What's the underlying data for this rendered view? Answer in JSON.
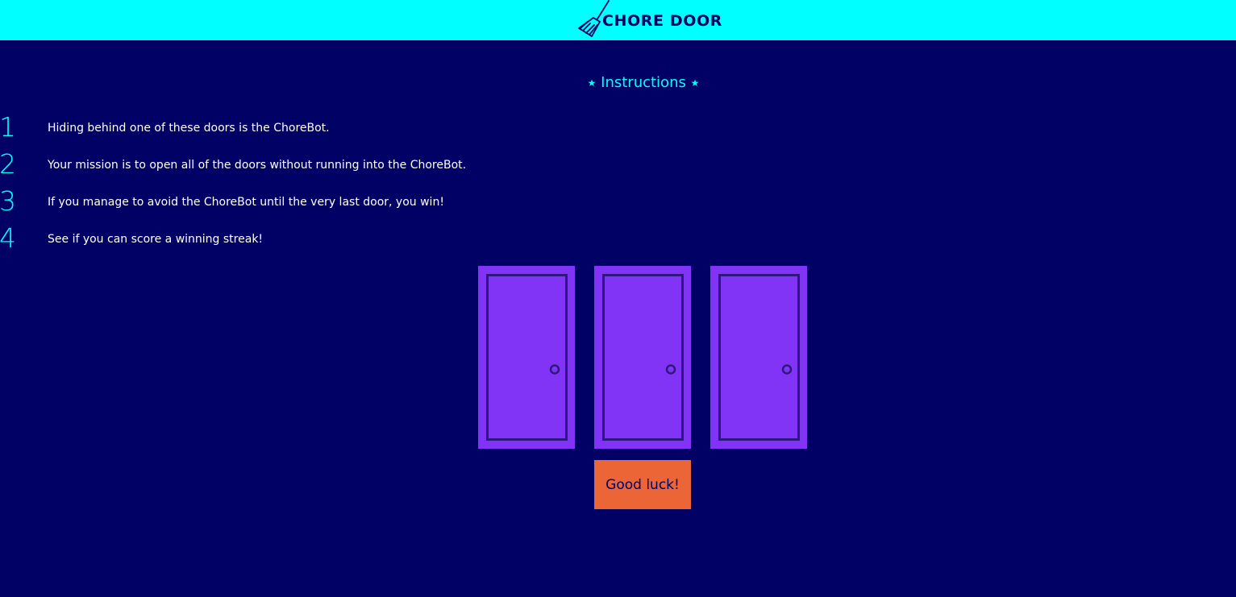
{
  "header": {
    "title": "CHORE DOOR",
    "icon": "broom-icon",
    "background": "#00ffff"
  },
  "instructions": {
    "title": "Instructions",
    "star": "★",
    "items": [
      {
        "number": "1",
        "text": "Hiding behind one of these doors is the ChoreBot."
      },
      {
        "number": "2",
        "text": "Your mission is to open all of the doors without running into the ChoreBot."
      },
      {
        "number": "3",
        "text": "If you manage to avoid the ChoreBot until the very last door, you win!"
      },
      {
        "number": "4",
        "text": "See if you can score a winning streak!"
      }
    ]
  },
  "doors": [
    {
      "icon": "closed-door-icon"
    },
    {
      "icon": "closed-door-icon"
    },
    {
      "icon": "closed-door-icon"
    }
  ],
  "start_button": {
    "label": "Good luck!"
  },
  "colors": {
    "page_background": "#010165",
    "accent": "#00ffff",
    "door": "#8134f5",
    "button": "#eb6536"
  }
}
